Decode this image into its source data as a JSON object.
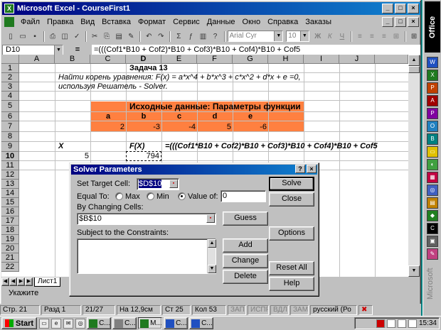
{
  "window": {
    "title": "Microsoft Excel - CourseFirst1",
    "min": "_",
    "max": "□",
    "close": "×"
  },
  "menu": [
    "Файл",
    "Правка",
    "Вид",
    "Вставка",
    "Формат",
    "Сервис",
    "Данные",
    "Окно",
    "Справка",
    "Заказы"
  ],
  "toolbar": {
    "font": "Arial Cyr",
    "size": "10"
  },
  "formula_bar": {
    "name_box": "D10",
    "equals": "=",
    "formula": "=(((Cof1*B10 + Cof2)*B10 + Cof3)*B10 + Cof4)*B10 + Cof5"
  },
  "columns": [
    "A",
    "B",
    "C",
    "D",
    "E",
    "F",
    "G",
    "H",
    "I",
    "J"
  ],
  "rows": [
    "1",
    "2",
    "3",
    "4",
    "5",
    "6",
    "7",
    "8",
    "9",
    "10",
    "11",
    "12",
    "13",
    "14",
    "15",
    "16",
    "17",
    "18",
    "19",
    "20",
    "21",
    "22"
  ],
  "cells": {
    "d1": "Задача 13",
    "b2": "Найти корень уравнения: F(x) = a*x^4 + b*x^3 + c*x^2 + d*x + e =0,",
    "b3": "используя Решатель - Solver.",
    "c5": "Исходные данные: Параметры функции",
    "c6": "a",
    "d6": "b",
    "e6": "c",
    "f6": "d",
    "g6": "e",
    "c7": "2",
    "d7": "-3",
    "e7": "-4",
    "f7": "5",
    "g7": "-6",
    "b9": "X",
    "d9": "F(X)",
    "e9": "=(((Cof1*B10 + Cof2)*B10 + Cof3)*B10 + Cof4)*B10 + Cof5",
    "b10": "5",
    "d10": "794"
  },
  "sheet_tab": "Лист1",
  "status_mode": "Укажите",
  "status2": {
    "page": "Стр. 21",
    "section": "Разд 1",
    "pages": "21/27",
    "pos": "На 12,9см",
    "line": "Ст 25",
    "col": "Кол 53",
    "rec": "ЗАП",
    "trk": "ИСПР",
    "ext": "ВДЛ",
    "ovr": "ЗАМ",
    "lang": "русский (Ро"
  },
  "dialog": {
    "title": "Solver Parameters",
    "help": "?",
    "close": "×",
    "set_target_label": "Set Target Cell:",
    "set_target_value": "$D$10",
    "equal_to_label": "Equal To:",
    "max_label": "Max",
    "min_label": "Min",
    "value_of_label": "Value of:",
    "value_of_value": "0",
    "by_changing_label": "By Changing Cells:",
    "by_changing_value": "$B$10",
    "guess": "Guess",
    "constraints_label": "Subject to the Constraints:",
    "add": "Add",
    "change": "Change",
    "delete": "Delete",
    "solve": "Solve",
    "close_btn": "Close",
    "options": "Options",
    "reset": "Reset All",
    "help_btn": "Help"
  },
  "taskbar": {
    "start": "Start",
    "tasks": [
      "C...",
      "C...",
      "M...",
      "C...",
      "C..."
    ],
    "clock": "15:34"
  },
  "office_bar": {
    "logo": "Office",
    "label": "Microsoft"
  }
}
